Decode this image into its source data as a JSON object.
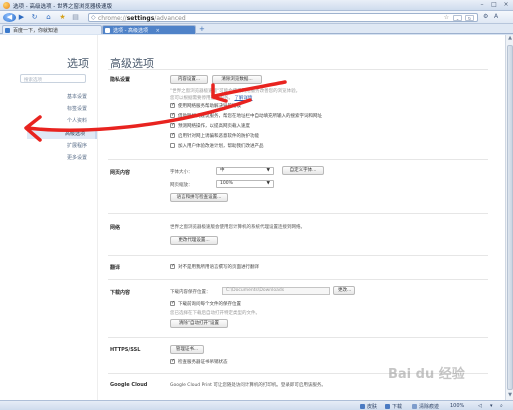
{
  "window": {
    "title": "选项 - 高级选项 - 世界之窗浏览器极速版",
    "minimize": "–",
    "maximize": "□",
    "close": "×"
  },
  "toolbar": {
    "back_icon": "back-arrow-icon",
    "forward_icon": "forward-arrow-icon",
    "url_prefix": "chrome://",
    "url_host": "settings",
    "url_path": "/advanced",
    "star": "☆",
    "right_buttons": [
      "⌄",
      "⚙",
      "A"
    ]
  },
  "tabs": {
    "inactive_label": "百度一下，你就知道",
    "active_label": "选项 - 高级选项",
    "close": "×",
    "new_tab": "+"
  },
  "sidebar": {
    "title": "选项",
    "search_placeholder": "搜索选项",
    "items": [
      "基本设置",
      "标签设置",
      "个人资料",
      "高级选项",
      "扩展程序",
      "更多设置"
    ]
  },
  "main": {
    "title": "高级选项",
    "privacy": {
      "label": "隐私设置",
      "content_settings": "内容设置...",
      "clear_data": "清除浏览数据...",
      "desc1": "\"世界之窗浏览器极速版\"可能会使用网络服务改善您的浏览体验。",
      "desc2": "您可以根据需要停用这些服务。",
      "learn_more": "了解详情",
      "options": [
        {
          "text": "使用网络服务帮助解决导航错误",
          "checked": true
        },
        {
          "text": "借助联想式建议服务，帮您在地址栏中自动填充所输入的搜索字词和网址",
          "checked": true
        },
        {
          "text": "预测网络操作，以提高网页载入速度",
          "checked": true
        },
        {
          "text": "启用针对网上诱骗和恶意软件的防护功能",
          "checked": true
        },
        {
          "text": "加入用户体验改进计划，帮助我们改进产品",
          "checked": false
        }
      ]
    },
    "web_content": {
      "label": "网页内容",
      "font_size_label": "字体大小：",
      "font_size_value": "中",
      "customize_fonts": "自定义字体...",
      "zoom_label": "网页缩放：",
      "zoom_value": "100%",
      "lang_settings": "语言和拼写检查设置..."
    },
    "network": {
      "label": "网络",
      "desc": "世界之窗浏览器极速版会使用您计算机的系统代理设置连接到网络。",
      "proxy_button": "更改代理设置..."
    },
    "translate": {
      "label": "翻译",
      "option": "对不是用我所用语言撰写的页面进行翻译",
      "checked": true
    },
    "downloads": {
      "label": "下载内容",
      "location_label": "下载内容保存位置：",
      "path": "C:\\Documents\\Downloads",
      "change_button": "更改...",
      "ask_option": "下载前询问每个文件的保存位置",
      "ask_checked": true,
      "auto_open_desc": "您已选择在下载后自动打开特定类型的文件。",
      "clear_auto_open": "清除\"自动打开\"设置"
    },
    "https": {
      "label": "HTTPS/SSL",
      "manage_certs": "管理证书...",
      "revocation_option": "检查服务器证书吊销状态",
      "checked": true
    },
    "cloud": {
      "label": "Google Cloud",
      "desc": "Google Cloud Print 可让您随处访问计算机的打印机。登录即可启用该服务。"
    }
  },
  "statusbar": {
    "items": [
      "皮肤",
      "下载",
      "清除痕迹",
      "100%"
    ]
  },
  "watermark": "Bai du 经验",
  "colors": {
    "accent": "#4f82c8",
    "annotation": "#e8231f"
  }
}
